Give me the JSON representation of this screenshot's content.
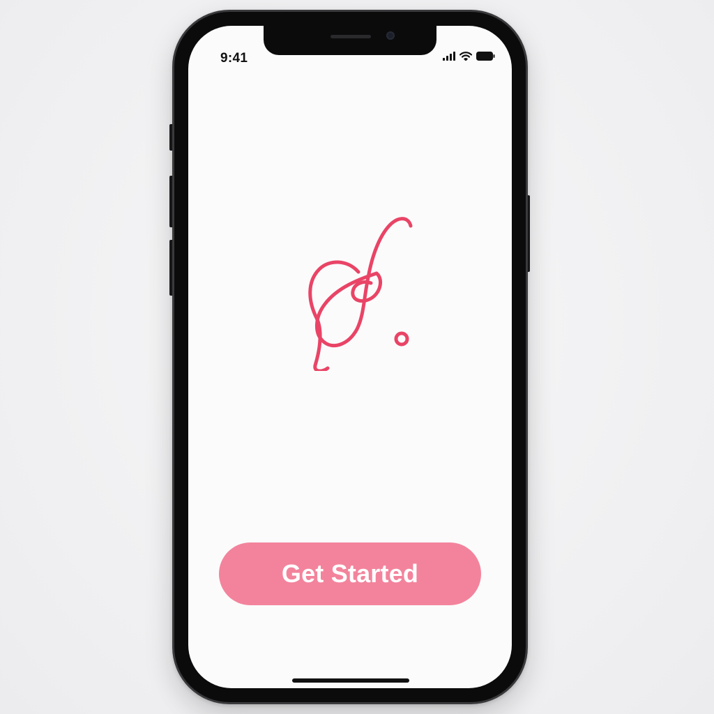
{
  "status_bar": {
    "time": "9:41",
    "icons": [
      "cellular-signal-icon",
      "wifi-icon",
      "battery-icon"
    ]
  },
  "logo": {
    "icon": "script-s-logo-icon",
    "color": "#e94466"
  },
  "cta": {
    "label": "Get Started",
    "background": "#f3839c",
    "text_color": "#ffffff"
  },
  "colors": {
    "frame": "#0b0b0c",
    "screen": "#fbfbfb",
    "accent": "#e94466"
  }
}
